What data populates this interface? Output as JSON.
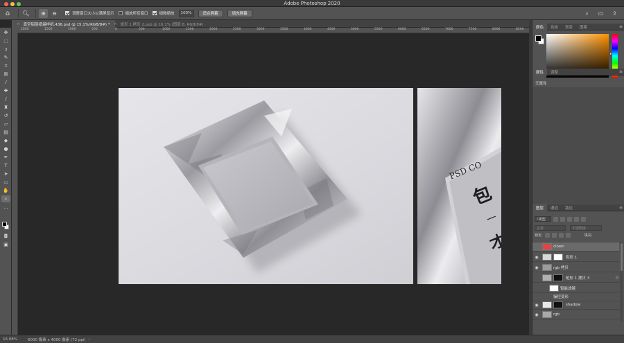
{
  "app": {
    "title": "Adobe Photoshop 2020"
  },
  "options": {
    "checkbox_resize": "调整窗口大小以满屏显示",
    "checkbox_zoom_all": "缩放所有窗口",
    "checkbox_scrubby": "细微缩放",
    "zoom_value": "100%",
    "fit_button": "适合屏幕",
    "fill_button": "填充屏幕"
  },
  "tabs": [
    {
      "label": "真空铝箔纸袋样机.436.psd @ 15.1%(RGB/8#) *"
    },
    {
      "label": "矩形 1 拷贝 2.psb @ 16.1% (图层 8, RGB/8#)"
    }
  ],
  "ruler": {
    "ticks": [
      "2000",
      "1500",
      "1000",
      "500",
      "0",
      "500",
      "1000",
      "1500",
      "2000",
      "2500",
      "3000",
      "3500",
      "4000",
      "4500",
      "5000",
      "5500",
      "6000",
      "6500",
      "7000",
      "7500",
      "8000",
      "8500"
    ]
  },
  "canvas": {
    "side_text_1": "PSD CO",
    "side_text_2": "包",
    "side_text_3": "一",
    "side_text_4": "才"
  },
  "status": {
    "zoom": "16.08%",
    "info": "6000 像素 x 4000 像素 (72 ppi)"
  },
  "panels": {
    "color_tabs": [
      "颜色",
      "色板",
      "渐变",
      "图案"
    ],
    "props_tabs": [
      "属性",
      "调整"
    ],
    "props_empty": "无属性",
    "layers_tabs": [
      "图层",
      "通道",
      "路径"
    ],
    "kind_label": "类型",
    "blend_mode": "正常",
    "opacity_label": "不透明度:",
    "lock_label": "锁定:",
    "fill_label": "填充:"
  },
  "layers": [
    {
      "name": "clown",
      "visible": false,
      "selected": true,
      "thumb": "#e04444"
    },
    {
      "name": "色彩 1",
      "visible": true,
      "selected": false,
      "thumb": "#d8d8d8"
    },
    {
      "name": "rgb 拷贝",
      "visible": true,
      "selected": false,
      "thumb": "#9c9c9c"
    },
    {
      "name": "矩形 1 拷贝 3",
      "visible": false,
      "selected": false,
      "thumb": "#b0b0b0"
    },
    {
      "name": "智能滤镜",
      "visible": false,
      "selected": false,
      "thumb": "#ffffff"
    },
    {
      "name": "操控变形",
      "visible": false,
      "selected": false,
      "thumb": ""
    },
    {
      "name": "shadow",
      "visible": true,
      "selected": false,
      "thumb": "#e8e8e8"
    },
    {
      "name": "rgb",
      "visible": true,
      "selected": false,
      "thumb": "#a8a8a8"
    }
  ],
  "colors": {
    "accent": "#ff9200",
    "panel_bg": "#535353",
    "canvas_bg": "#282828"
  }
}
